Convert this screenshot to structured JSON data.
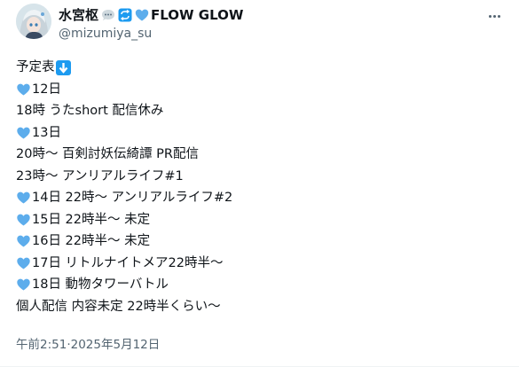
{
  "author": {
    "display_name": "水宮枢",
    "display_name_suffix": "FLOW GLOW",
    "handle": "@mizumiya_su",
    "badge_icons": [
      "speech-bubble-icon",
      "repeat-arrows-icon",
      "blue-heart-icon"
    ]
  },
  "post": {
    "lines": [
      {
        "text": "予定表",
        "icon_before": null,
        "icon_after": "down-arrow-emoji"
      },
      {
        "text": "12日",
        "icon_before": "blue-heart-emoji",
        "icon_after": null
      },
      {
        "text": "18時 うたshort 配信休み",
        "icon_before": null,
        "icon_after": null
      },
      {
        "text": "13日",
        "icon_before": "blue-heart-emoji",
        "icon_after": null
      },
      {
        "text": "20時～ 百剣討妖伝綺譚 PR配信",
        "icon_before": null,
        "icon_after": null
      },
      {
        "text": "23時～ アンリアルライフ#1",
        "icon_before": null,
        "icon_after": null
      },
      {
        "text": "14日 22時～ アンリアルライフ#2",
        "icon_before": "blue-heart-emoji",
        "icon_after": null
      },
      {
        "text": "15日 22時半～ 未定",
        "icon_before": "blue-heart-emoji",
        "icon_after": null
      },
      {
        "text": "16日 22時半～ 未定",
        "icon_before": "blue-heart-emoji",
        "icon_after": null
      },
      {
        "text": "17日 リトルナイトメア22時半～",
        "icon_before": "blue-heart-emoji",
        "icon_after": null
      },
      {
        "text": "18日 動物タワーバトル",
        "icon_before": "blue-heart-emoji",
        "icon_after": null
      },
      {
        "text": "個人配信 内容未定 22時半くらい～",
        "icon_before": null,
        "icon_after": null
      }
    ],
    "timestamp_time": "午前2:51",
    "timestamp_sep": " · ",
    "timestamp_date": "2025年5月12日"
  },
  "colors": {
    "text": "#0f1419",
    "secondary": "#536471",
    "heart": "#5dadec",
    "accent": "#1d9bf0"
  }
}
